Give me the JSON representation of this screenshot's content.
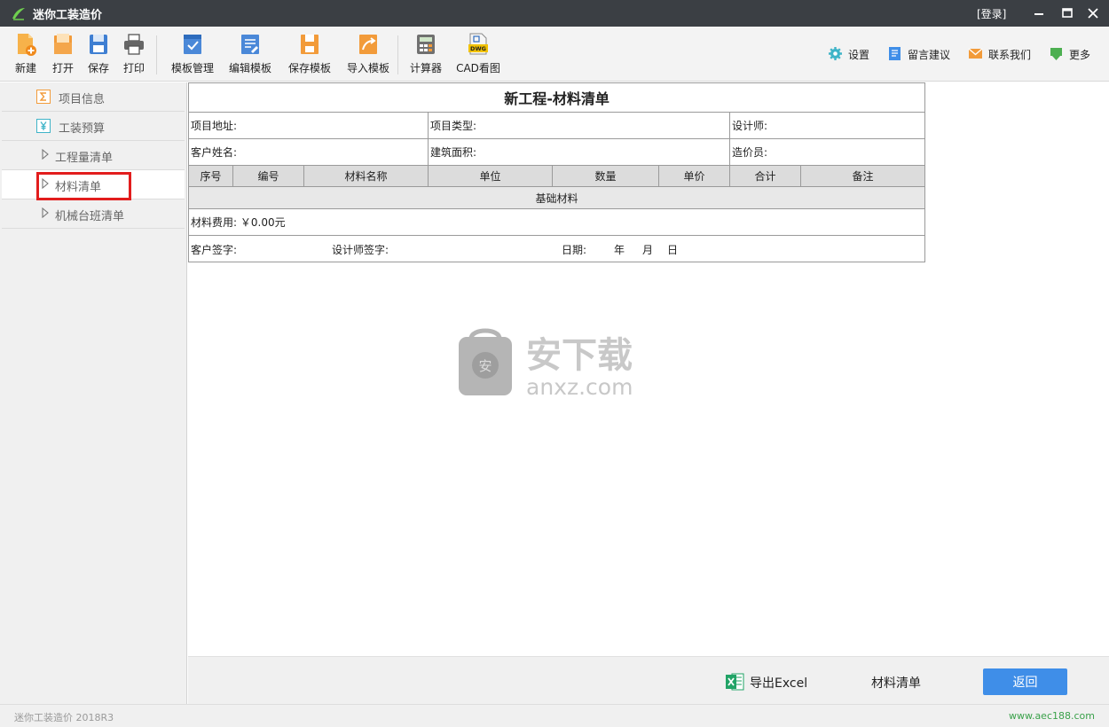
{
  "app": {
    "title": "迷你工装造价",
    "login": "[登录]"
  },
  "toolbar": {
    "left": [
      {
        "label": "新建",
        "icon": "new-file-icon"
      },
      {
        "label": "打开",
        "icon": "open-folder-icon"
      },
      {
        "label": "保存",
        "icon": "save-disk-icon"
      },
      {
        "label": "打印",
        "icon": "printer-icon"
      },
      {
        "label": "模板管理",
        "icon": "template-manage-icon"
      },
      {
        "label": "编辑模板",
        "icon": "edit-template-icon"
      },
      {
        "label": "保存模板",
        "icon": "save-template-icon"
      },
      {
        "label": "导入模板",
        "icon": "import-template-icon"
      },
      {
        "label": "计算器",
        "icon": "calculator-icon"
      },
      {
        "label": "CAD看图",
        "icon": "dwg-file-icon"
      }
    ],
    "right": [
      {
        "label": "设置",
        "icon": "gear-icon"
      },
      {
        "label": "留言建议",
        "icon": "message-icon"
      },
      {
        "label": "联系我们",
        "icon": "envelope-icon"
      },
      {
        "label": "更多",
        "icon": "download-more-icon"
      }
    ]
  },
  "sidebar": {
    "items": [
      {
        "label": "项目信息",
        "icon": "sigma-icon"
      },
      {
        "label": "工装预算",
        "icon": "yen-icon"
      },
      {
        "label": "工程量清单",
        "icon": "triangle-right-icon"
      },
      {
        "label": "材料清单",
        "icon": "triangle-right-icon",
        "active": true
      },
      {
        "label": "机械台班清单",
        "icon": "triangle-right-icon"
      }
    ]
  },
  "sheet": {
    "title": "新工程-材料清单",
    "address": "项目地址:",
    "project_type": "项目类型:",
    "designer": "设计师:",
    "client_name": "客户姓名:",
    "building_area": "建筑面积:",
    "estimator": "造价员:",
    "headers": [
      "序号",
      "编号",
      "材料名称",
      "单位",
      "数量",
      "单价",
      "合计",
      "备注"
    ],
    "category": "基础材料",
    "material_cost_label": "材料费用:",
    "material_cost_value": "￥0.00元",
    "client_sign": "客户签字:",
    "designer_sign": "设计师签字:",
    "date_label": "日期:",
    "year": "年",
    "month": "月",
    "day": "日"
  },
  "watermark": {
    "text_cn": "安下载",
    "text_en": "anxz.com"
  },
  "bottom": {
    "export_label": "导出Excel",
    "current_label": "材料清单",
    "back_label": "返回"
  },
  "status": {
    "version": "迷你工装造价 2018R3",
    "url": "www.aec188.com"
  }
}
